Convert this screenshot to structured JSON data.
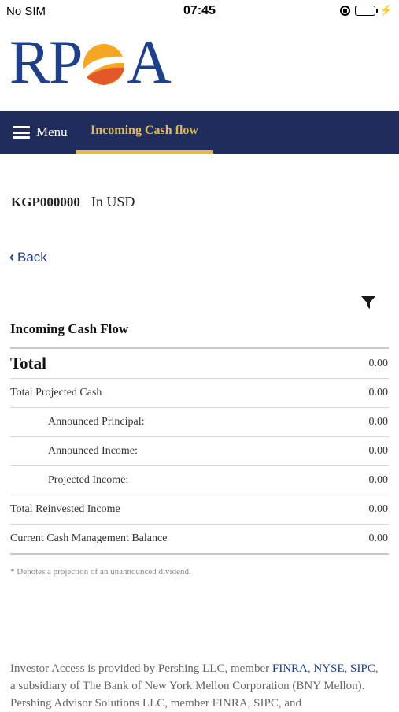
{
  "status_bar": {
    "carrier": "No SIM",
    "time": "07:45",
    "battery_color": "#4cd964"
  },
  "logo": {
    "text_left": "RP",
    "text_right": "A",
    "brand_color": "#1e3f8c",
    "sun_colors": [
      "#f5a623",
      "#e2582a"
    ]
  },
  "nav": {
    "menu_label": "Menu",
    "active_tab": "Incoming Cash flow",
    "bar_color": "#1f2c5c",
    "accent_color": "#e6b84a"
  },
  "account": {
    "id": "KGP000000",
    "currency": "In USD"
  },
  "back_label": "Back",
  "section_title": "Incoming Cash Flow",
  "rows": [
    {
      "label": "Total",
      "value": "0.00"
    },
    {
      "label": "Total Projected Cash",
      "value": "0.00"
    },
    {
      "label": "Announced Principal:",
      "value": "0.00"
    },
    {
      "label": "Announced Income:",
      "value": "0.00"
    },
    {
      "label": "Projected Income:",
      "value": "0.00"
    },
    {
      "label": "Total Reinvested Income",
      "value": "0.00"
    },
    {
      "label": "Current Cash Management Balance",
      "value": "0.00"
    }
  ],
  "note": "* Denotes a projection of an unannounced dividend.",
  "footer": {
    "t1": "Investor Access is provided by Pershing LLC, member ",
    "finra": "FINRA",
    "sep1": ", ",
    "nyse": "NYSE",
    "sep2": ", ",
    "sipc": "SIPC",
    "t2": ", a subsidiary of The Bank of New York Mellon Corporation (BNY Mellon). Pershing Advisor Solutions LLC, member FINRA, SIPC, and"
  }
}
